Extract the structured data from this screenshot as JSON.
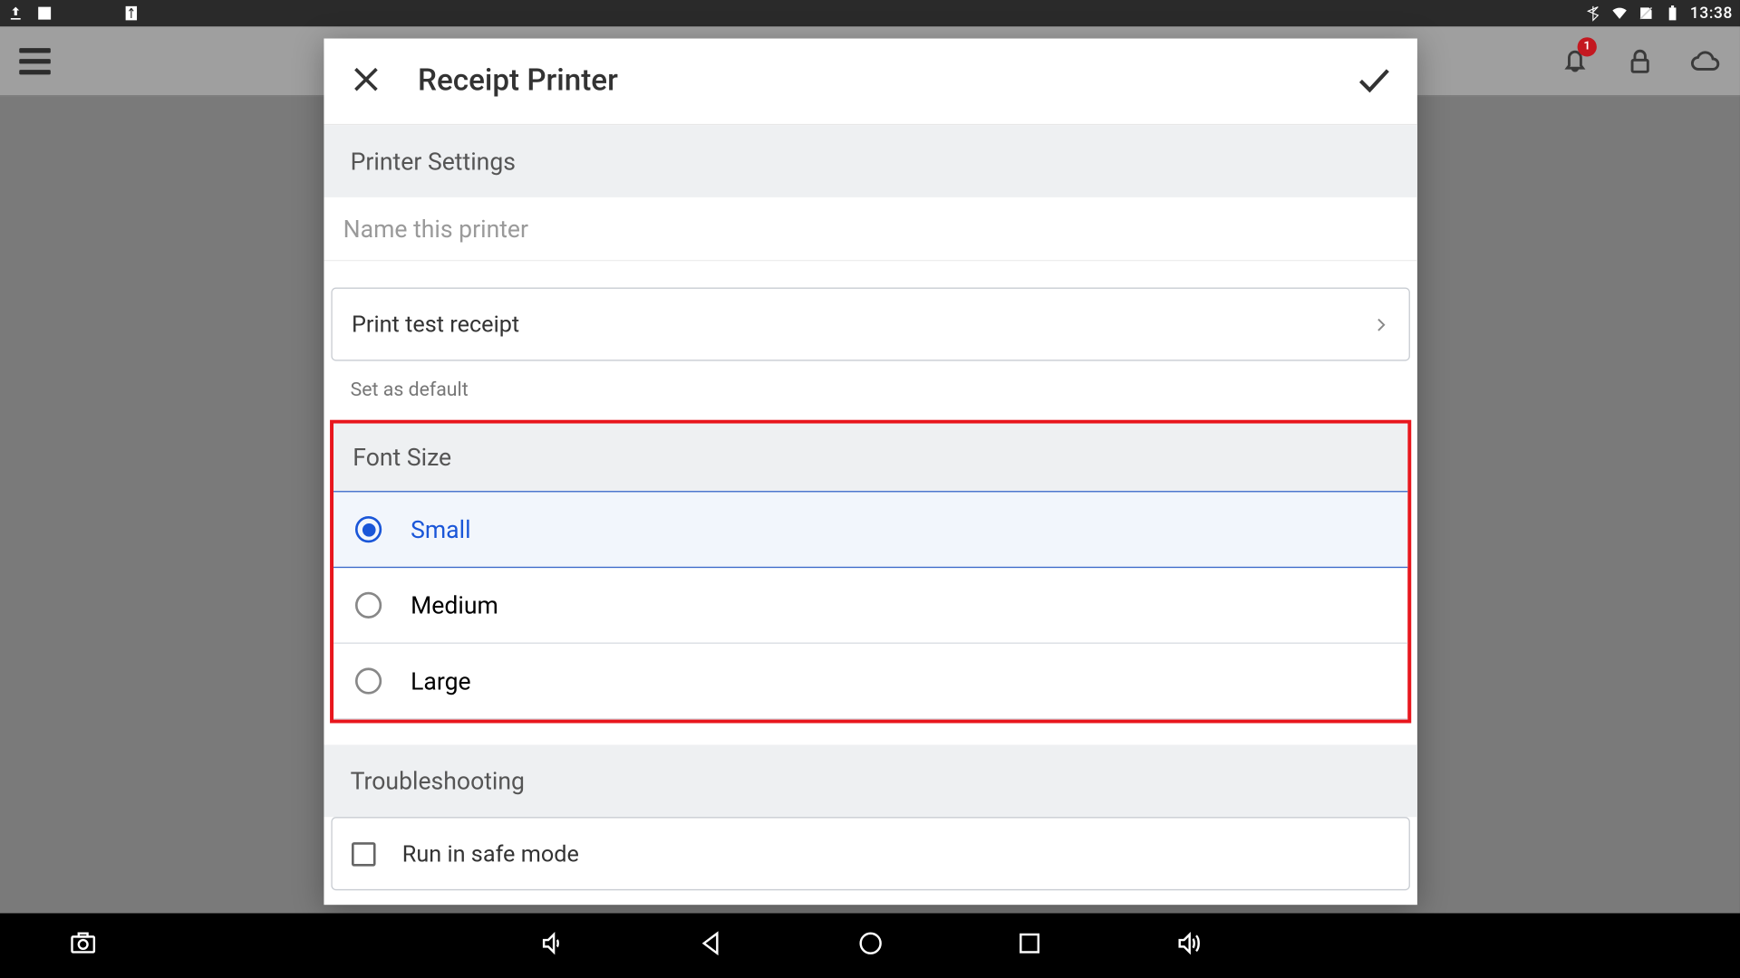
{
  "status": {
    "time": "13:38"
  },
  "topbar": {
    "notification_count": "1"
  },
  "modal": {
    "title": "Receipt Printer",
    "sections": {
      "printer_settings": "Printer Settings",
      "name_placeholder": "Name this printer",
      "test_receipt": "Print test receipt",
      "set_default": "Set as default",
      "font_size": "Font Size",
      "options": {
        "small": "Small",
        "medium": "Medium",
        "large": "Large"
      },
      "selected": "small",
      "troubleshooting": "Troubleshooting",
      "safe_mode": "Run in safe mode"
    }
  }
}
